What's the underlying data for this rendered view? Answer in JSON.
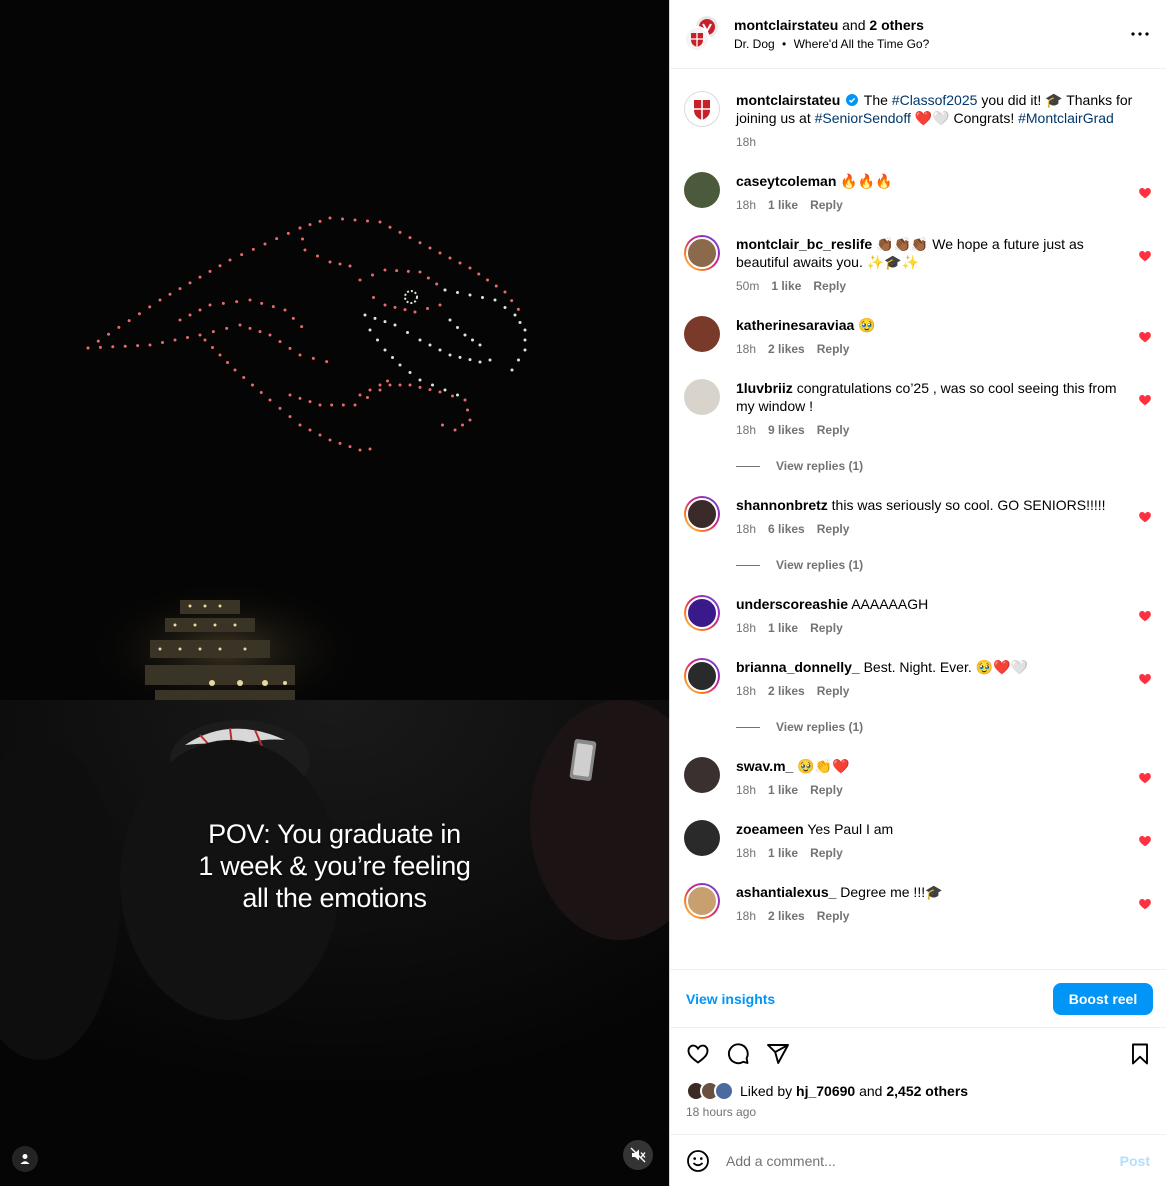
{
  "header": {
    "account": "montclairstateu",
    "and_text": "and",
    "others": "2 others",
    "audio_artist": "Dr. Dog",
    "audio_sep": "•",
    "audio_title": "Where'd All the Time Go?"
  },
  "video": {
    "caption_line1": "POV: You graduate in",
    "caption_line2": "1 week & you’re feeling",
    "caption_line3": "all the emotions"
  },
  "caption": {
    "user": "montclairstateu",
    "text_before": "The",
    "tag1": "#Classof2025",
    "text_mid1": "you did it! 🎓 Thanks for joining us at",
    "tag2": "#SeniorSendoff",
    "text_mid2": "❤️🤍 Congrats!",
    "tag3": "#MontclairGrad",
    "time": "18h"
  },
  "comments": [
    {
      "user": "caseytcoleman",
      "text": "🔥🔥🔥",
      "time": "18h",
      "likes": "1 like",
      "reply": "Reply",
      "avatar": "#4a5a3a",
      "ring": false
    },
    {
      "user": "montclair_bc_reslife",
      "text": "👏🏾👏🏾👏🏾 We hope a future just as beautiful awaits you. ✨🎓✨",
      "time": "50m",
      "likes": "1 like",
      "reply": "Reply",
      "avatar": "#8a6a4a",
      "ring": true
    },
    {
      "user": "katherinesaraviaa",
      "text": "🥹",
      "time": "18h",
      "likes": "2 likes",
      "reply": "Reply",
      "avatar": "#7a3a2a",
      "ring": false
    },
    {
      "user": "1luvbriiz",
      "text": "congratulations co’25 , was so cool seeing this from my window !",
      "time": "18h",
      "likes": "9 likes",
      "reply": "Reply",
      "avatar": "#d8d4cc",
      "ring": false,
      "view_replies": "View replies (1)"
    },
    {
      "user": "shannonbretz",
      "text": "this was seriously so cool. GO SENIORS!!!!!",
      "time": "18h",
      "likes": "6 likes",
      "reply": "Reply",
      "avatar": "#3a2a2a",
      "ring": true,
      "view_replies": "View replies (1)"
    },
    {
      "user": "underscoreashie",
      "text": "AAAAAAGH",
      "time": "18h",
      "likes": "1 like",
      "reply": "Reply",
      "avatar": "#3a1a8a",
      "ring": true
    },
    {
      "user": "brianna_donnelly_",
      "text": "Best. Night. Ever. 🥹❤️🤍",
      "time": "18h",
      "likes": "2 likes",
      "reply": "Reply",
      "avatar": "#2a2a2a",
      "ring": true,
      "view_replies": "View replies (1)"
    },
    {
      "user": "swav.m_",
      "text": "🥹👏❤️",
      "time": "18h",
      "likes": "1 like",
      "reply": "Reply",
      "avatar": "#3a3030",
      "ring": false
    },
    {
      "user": "zoeameen",
      "text": "Yes Paul I am",
      "time": "18h",
      "likes": "1 like",
      "reply": "Reply",
      "avatar": "#2a2a2a",
      "ring": false
    },
    {
      "user": "ashantialexus_",
      "text": "Degree me !!!🎓",
      "time": "18h",
      "likes": "2 likes",
      "reply": "Reply",
      "avatar": "#c8a070",
      "ring": true
    }
  ],
  "insights": {
    "view_label": "View insights",
    "boost_label": "Boost reel"
  },
  "likes": {
    "prefix": "Liked by",
    "user": "hj_70690",
    "mid": "and",
    "count": "2,452 others"
  },
  "posted": "18 hours ago",
  "comment_box": {
    "placeholder": "Add a comment...",
    "post_label": "Post"
  },
  "colors": {
    "accent": "#0095f6",
    "heart": "#ff3040",
    "link": "#00376b",
    "muted": "#737373"
  }
}
